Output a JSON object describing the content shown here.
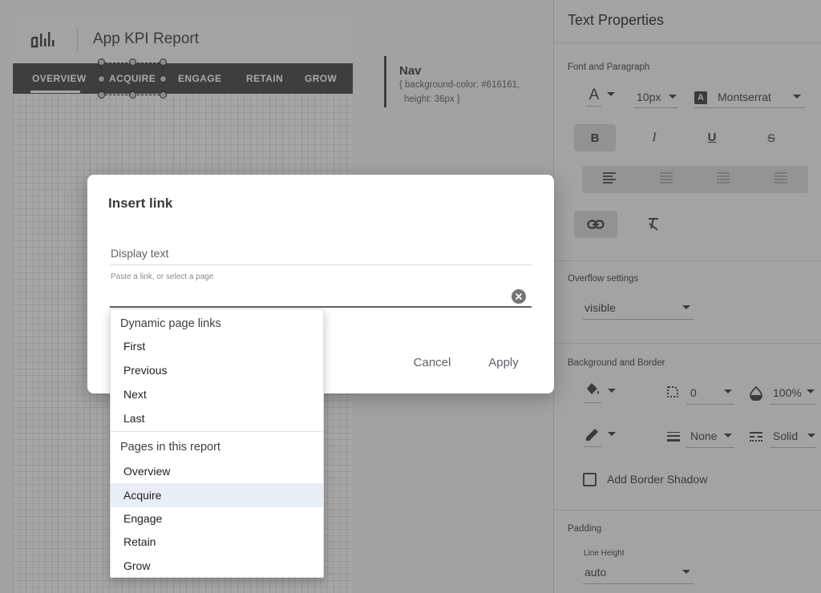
{
  "report": {
    "title": "App KPI Report",
    "nav_items": [
      "OVERVIEW",
      "ACQUIRE",
      "ENGAGE",
      "RETAIN",
      "GROW"
    ],
    "info_title": "Nav",
    "info_line1": "{ background-color: #616161,",
    "info_line2": "height: 36px }"
  },
  "panel": {
    "title": "Text Properties",
    "font_section": "Font and Paragraph",
    "font_size": "10px",
    "font_family": "Montserrat",
    "overflow_section": "Overflow settings",
    "overflow_value": "visible",
    "bg_section": "Background and Border",
    "border_radius": "0",
    "opacity": "100%",
    "border_weight": "None",
    "border_style": "Solid",
    "add_border_shadow": "Add Border Shadow",
    "padding_section": "Padding",
    "line_height_label": "Line Height",
    "line_height_value": "auto",
    "icons": {
      "text_color": "text-color-icon",
      "font_family_badge": "font-badge-icon",
      "bold": "bold-icon",
      "italic": "italic-icon",
      "underline": "underline-icon",
      "strikethrough": "strikethrough-icon",
      "link": "link-icon",
      "clear_format": "clear-format-icon",
      "fill": "fill-color-icon",
      "corner": "border-radius-icon",
      "opacity": "opacity-icon",
      "border_color": "border-color-icon"
    }
  },
  "dialog": {
    "title": "Insert link",
    "display_text_placeholder": "Display text",
    "link_helper": "Paste a link, or select a page",
    "cancel": "Cancel",
    "apply": "Apply"
  },
  "dropdown": {
    "group1": "Dynamic page links",
    "group1_items": [
      "First",
      "Previous",
      "Next",
      "Last"
    ],
    "group2": "Pages in this report",
    "group2_items": [
      "Overview",
      "Acquire",
      "Engage",
      "Retain",
      "Grow"
    ],
    "selected": "Acquire"
  },
  "colors": {
    "overlay": "#a2a2a2",
    "nav_bg": "#3e3e3e",
    "selected_item_bg": "#e8edf6"
  }
}
